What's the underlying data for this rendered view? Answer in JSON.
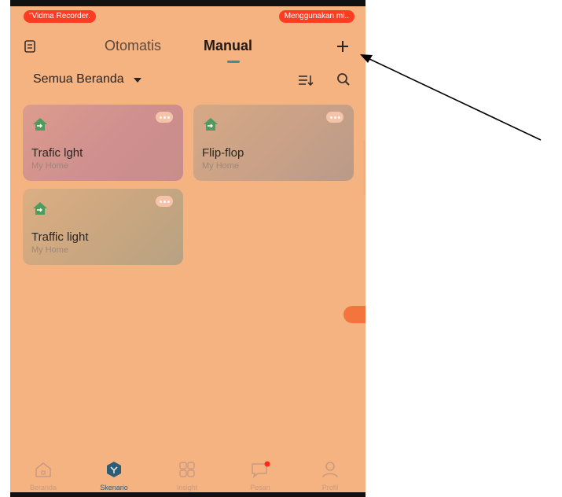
{
  "status_bar": {
    "recording_label": "\"Vidma Recorder.",
    "mic_label": "Menggunakan mi.."
  },
  "header": {
    "tabs": [
      {
        "label": "Otomatis",
        "active": false
      },
      {
        "label": "Manual",
        "active": true
      }
    ],
    "menu_icon": "list-icon",
    "add_icon": "plus-icon"
  },
  "filter": {
    "label": "Semua Beranda",
    "sort_icon": "sort-icon",
    "search_icon": "search-icon"
  },
  "scenes": [
    {
      "title": "Trafic lght",
      "location": "My Home"
    },
    {
      "title": "Flip-flop",
      "location": "My Home"
    },
    {
      "title": "Traffic light",
      "location": "My Home"
    }
  ],
  "bottom_nav": [
    {
      "label": "Beranda",
      "icon": "home-icon",
      "active": false
    },
    {
      "label": "Skenario",
      "icon": "scenario-icon",
      "active": true
    },
    {
      "label": "Insight",
      "icon": "grid-icon",
      "active": false
    },
    {
      "label": "Pesan",
      "icon": "message-icon",
      "active": false
    },
    {
      "label": "Profil",
      "icon": "profile-icon",
      "active": false
    }
  ],
  "colors": {
    "overlay": "#f6b382",
    "accent": "#3d8f95",
    "recording_pill": "#ff3b22",
    "float_button": "#f4743e"
  }
}
